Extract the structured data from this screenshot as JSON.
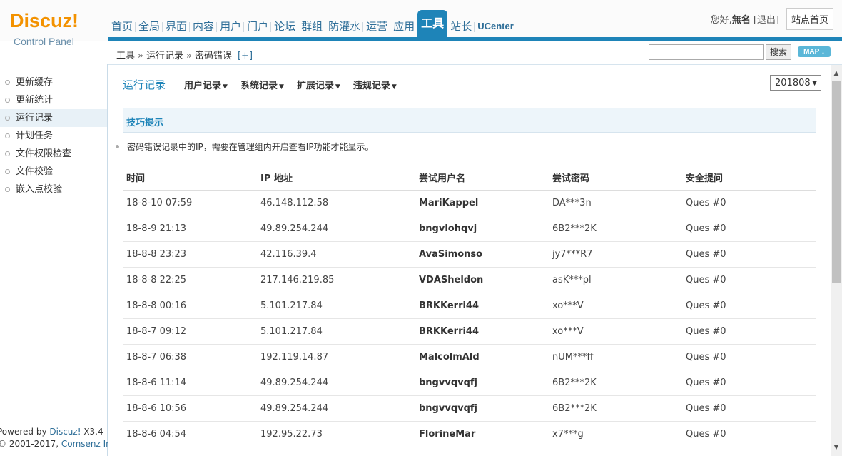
{
  "logo": {
    "title": "Discuz!",
    "subtitle": "Control Panel"
  },
  "topnav": [
    {
      "label": "首页"
    },
    {
      "label": "全局"
    },
    {
      "label": "界面"
    },
    {
      "label": "内容"
    },
    {
      "label": "用户"
    },
    {
      "label": "门户"
    },
    {
      "label": "论坛"
    },
    {
      "label": "群组"
    },
    {
      "label": "防灌水"
    },
    {
      "label": "运营"
    },
    {
      "label": "应用"
    },
    {
      "label": "工具",
      "active": true
    },
    {
      "label": "站长"
    },
    {
      "label": "UCenter"
    }
  ],
  "user": {
    "greeting": "您好,",
    "name": "無名",
    "logout": "[退出]",
    "site_home": "站点首页"
  },
  "breadcrumb": {
    "part1": "工具",
    "sep": "»",
    "part2": "运行记录",
    "part3": "密码错误",
    "add": "[+]"
  },
  "search": {
    "value": "",
    "button": "搜索",
    "map": "MAP ↓"
  },
  "sidebar": {
    "items": [
      {
        "label": "更新缓存"
      },
      {
        "label": "更新统计"
      },
      {
        "label": "运行记录",
        "active": true
      },
      {
        "label": "计划任务"
      },
      {
        "label": "文件权限检查"
      },
      {
        "label": "文件校验"
      },
      {
        "label": "嵌入点校验"
      }
    ],
    "footer": {
      "powered": "Powered by ",
      "product": "Discuz!",
      "version": " X3.4",
      "copyright": "© 2001-2017, ",
      "company": "Comsenz Inc."
    }
  },
  "tabs": {
    "main": "运行记录",
    "items": [
      {
        "label": "用户记录"
      },
      {
        "label": "系统记录"
      },
      {
        "label": "扩展记录"
      },
      {
        "label": "违规记录"
      }
    ]
  },
  "month_select": {
    "value": "201808"
  },
  "tips": {
    "title": "技巧提示",
    "line": "密码错误记录中的IP，需要在管理组内开启查看IP功能才能显示。"
  },
  "table": {
    "headers": [
      "时间",
      "IP 地址",
      "尝试用户名",
      "尝试密码",
      "安全提问"
    ],
    "rows": [
      [
        "18-8-10 07:59",
        "46.148.112.58",
        "MariKappel",
        "DA***3n",
        "Ques #0"
      ],
      [
        "18-8-9 21:13",
        "49.89.254.244",
        "bngvlohqvj",
        "6B2***2K",
        "Ques #0"
      ],
      [
        "18-8-8 23:23",
        "42.116.39.4",
        "AvaSimonso",
        "jy7***R7",
        "Ques #0"
      ],
      [
        "18-8-8 22:25",
        "217.146.219.85",
        "VDASheldon",
        "asK***pl",
        "Ques #0"
      ],
      [
        "18-8-8 00:16",
        "5.101.217.84",
        "BRKKerri44",
        "xo***V",
        "Ques #0"
      ],
      [
        "18-8-7 09:12",
        "5.101.217.84",
        "BRKKerri44",
        "xo***V",
        "Ques #0"
      ],
      [
        "18-8-7 06:38",
        "192.119.14.87",
        "MalcolmAld",
        "nUM***ff",
        "Ques #0"
      ],
      [
        "18-8-6 11:14",
        "49.89.254.244",
        "bngvvqvqfj",
        "6B2***2K",
        "Ques #0"
      ],
      [
        "18-8-6 10:56",
        "49.89.254.244",
        "bngvvqvqfj",
        "6B2***2K",
        "Ques #0"
      ],
      [
        "18-8-6 04:54",
        "192.95.22.73",
        "FlorineMar",
        "x7***g",
        "Ques #0"
      ]
    ]
  },
  "colors": {
    "accent": "#1e84b8",
    "logo": "#f39200",
    "link": "#2e6e98"
  }
}
